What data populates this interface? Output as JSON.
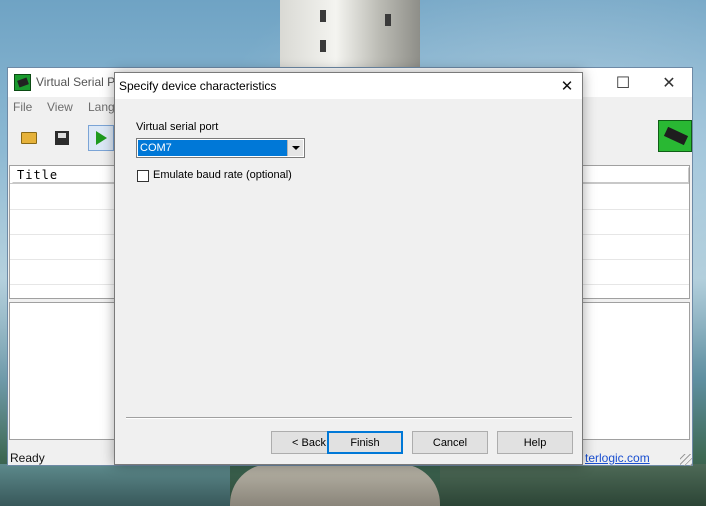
{
  "app": {
    "title": "Virtual Serial Po",
    "window_controls": {
      "minimize": "—",
      "maximize": "☐",
      "close": "✕"
    },
    "menu": [
      "File",
      "View",
      "Langu"
    ],
    "list": {
      "column_header": "Title"
    },
    "status": {
      "text": "Ready",
      "link": "terlogic.com"
    }
  },
  "dialog": {
    "title": "Specify device characteristics",
    "close_glyph": "✕",
    "port_label": "Virtual serial port",
    "port_value": "COM7",
    "emulate_label": "Emulate baud rate (optional)",
    "emulate_checked": false,
    "buttons": {
      "back": "< Back",
      "finish": "Finish",
      "cancel": "Cancel",
      "help": "Help"
    }
  },
  "colors": {
    "accent": "#0078d7",
    "link": "#1a4fd0"
  }
}
